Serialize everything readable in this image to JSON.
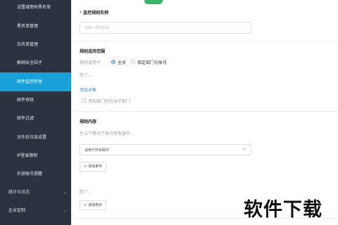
{
  "sidebar": {
    "items": [
      {
        "label": "设置域密码黑名单"
      },
      {
        "label": "黑名单管理"
      },
      {
        "label": "白名单管理"
      },
      {
        "label": "解绑安全因子"
      },
      {
        "label": "邮件监控转发"
      },
      {
        "label": "邮件审核"
      },
      {
        "label": "邮件过滤"
      },
      {
        "label": "对外反垃圾设置"
      },
      {
        "label": "IP登录限制"
      },
      {
        "label": "外部账号提醒"
      },
      {
        "label": "统计与日志"
      },
      {
        "label": "企业定制"
      }
    ]
  },
  "form": {
    "name_required_mark": "*",
    "name_label": "监控规则名称",
    "name_placeholder": "请输入规则名称",
    "scope_title": "规则适用范围",
    "scope_label": "规则适用于",
    "scope_option_all": "全员",
    "scope_option_specific": "指定部门与账号",
    "except_label_1": "除了...",
    "add_object_link": "添加对象",
    "include_sub_label": "添加部门时包含子部门",
    "content_title": "规则内容",
    "content_hint": "在以下情况下执行转发操作...",
    "condition_select": "适用于所有邮件",
    "add_condition_button": "添加条件",
    "except_label_2": "除了...",
    "add_exception_button": "添加例外"
  },
  "watermark": {
    "text": "软件下载"
  },
  "colors": {
    "sidebar_bg": "#2b3240",
    "sidebar_active": "#19a0d8",
    "accent": "#2d86e0",
    "toggle_on": "#3bb36a"
  }
}
